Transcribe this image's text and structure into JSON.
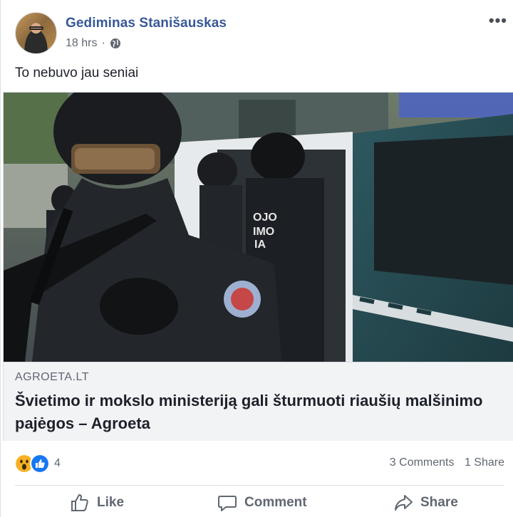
{
  "post": {
    "author": "Gediminas Stanišauskas",
    "timestamp": "18 hrs",
    "separator": "·",
    "privacy_icon": "globe-icon",
    "more_label": "•••",
    "text": "To nebuvo jau seniai"
  },
  "link": {
    "domain": "AGROETA.LT",
    "headline": "Švietimo ir mokslo ministeriją gali šturmuoti riaušių malšinimo pajėgos – Agroeta",
    "image_text": "OJO\nIMO\nIA"
  },
  "reactions": {
    "icons": [
      "wow-icon",
      "like-icon"
    ],
    "count": "4",
    "comments": "3 Comments",
    "shares": "1 Share"
  },
  "actions": {
    "like": "Like",
    "comment": "Comment",
    "share": "Share"
  },
  "colors": {
    "author_blue": "#385898",
    "like_blue": "#1877f2",
    "wow_yellow": "#f7b125",
    "muted": "#606770"
  }
}
